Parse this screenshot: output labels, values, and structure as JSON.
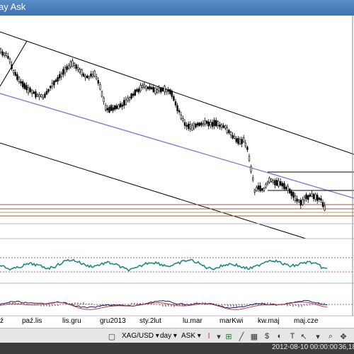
{
  "window": {
    "title": "ay Ask"
  },
  "xaxis": {
    "labels": [
      "ź",
      "paź.lis",
      "lis.gru",
      "gru2013",
      "sty.2lut",
      "lu.mar",
      "marKwi",
      "kw.maj",
      "maj.cze"
    ]
  },
  "toolbar": {
    "symbol": "XAG/USD",
    "period": "day",
    "price": "ASK"
  },
  "status": {
    "datetime": "2012-08-10 00:00:00",
    "value": "36,18"
  },
  "colors": {
    "titlebar": "#4a80bf",
    "candles": "#000000",
    "median_line": "#7d7de0",
    "indicator1": "#1f8a80",
    "macd_line": "#0b1f6e",
    "signal_line": "#c83a3a",
    "level_brown": "#9b5a3f",
    "level_orange": "#c79a3a",
    "grid_dotted": "#c06060"
  }
}
